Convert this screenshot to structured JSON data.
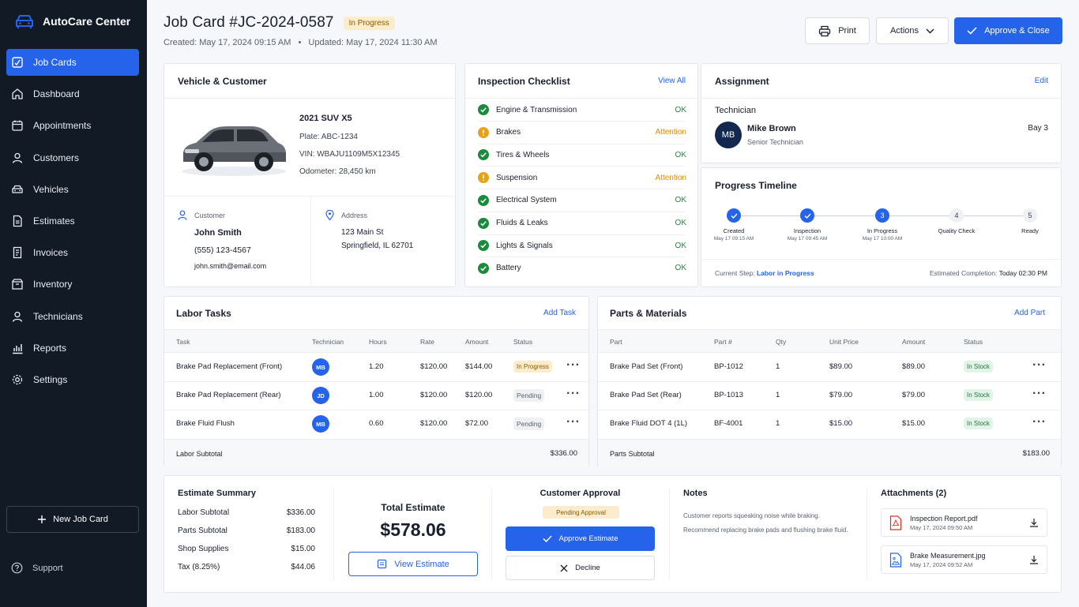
{
  "app": {
    "name": "AutoCare Center"
  },
  "sidebar": {
    "items": [
      {
        "label": "Job Cards",
        "icon": "job-cards-icon",
        "active": true
      },
      {
        "label": "Dashboard",
        "icon": "home-icon"
      },
      {
        "label": "Appointments",
        "icon": "calendar-icon"
      },
      {
        "label": "Customers",
        "icon": "user-icon"
      },
      {
        "label": "Vehicles",
        "icon": "car-icon"
      },
      {
        "label": "Estimates",
        "icon": "document-icon"
      },
      {
        "label": "Invoices",
        "icon": "invoice-icon"
      },
      {
        "label": "Inventory",
        "icon": "box-icon"
      },
      {
        "label": "Technicians",
        "icon": "wrench-user-icon"
      },
      {
        "label": "Reports",
        "icon": "bar-chart-icon"
      },
      {
        "label": "Settings",
        "icon": "gear-icon"
      }
    ],
    "new_job_label": "New Job Card",
    "support_label": "Support"
  },
  "header": {
    "title": "Job Card #JC-2024-0587",
    "status": "In Progress",
    "created": "Created: May 17, 2024 09:15 AM",
    "separator": "•",
    "updated": "Updated: May 17, 2024 11:30 AM",
    "print_label": "Print",
    "actions_label": "Actions",
    "approve_close_label": "Approve & Close"
  },
  "vehicle": {
    "heading": "Vehicle & Customer",
    "model": "2021 SUV X5",
    "plate": "Plate: ABC-1234",
    "vin": "VIN: WBAJU1109M5X12345",
    "odometer": "Odometer: 28,450 km",
    "customer_label": "Customer",
    "customer_name": "John Smith",
    "phone": "(555) 123-4567",
    "email": "john.smith@email.com",
    "address_label": "Address",
    "address_line1": "123 Main St",
    "address_line2": "Springfield, IL 62701"
  },
  "checklist": {
    "heading": "Inspection Checklist",
    "view_all": "View All",
    "items": [
      {
        "label": "Engine & Transmission",
        "status": "OK",
        "state": "ok"
      },
      {
        "label": "Brakes",
        "status": "Attention",
        "state": "attention"
      },
      {
        "label": "Tires & Wheels",
        "status": "OK",
        "state": "ok"
      },
      {
        "label": "Suspension",
        "status": "Attention",
        "state": "attention"
      },
      {
        "label": "Electrical System",
        "status": "OK",
        "state": "ok"
      },
      {
        "label": "Fluids & Leaks",
        "status": "OK",
        "state": "ok"
      },
      {
        "label": "Lights & Signals",
        "status": "OK",
        "state": "ok"
      },
      {
        "label": "Battery",
        "status": "OK",
        "state": "ok"
      }
    ]
  },
  "assignment": {
    "heading": "Assignment",
    "edit": "Edit",
    "technician_label": "Technician",
    "initials": "MB",
    "name": "Mike Brown",
    "role": "Senior Technician",
    "bay": "Bay 3"
  },
  "timeline": {
    "heading": "Progress Timeline",
    "steps": [
      {
        "num": "",
        "label": "Created",
        "date": "May 17 09:15 AM",
        "state": "done"
      },
      {
        "num": "",
        "label": "Inspection",
        "date": "May 17 09:45 AM",
        "state": "done"
      },
      {
        "num": "3",
        "label": "In Progress",
        "date": "May 17 10:00 AM",
        "state": "current"
      },
      {
        "num": "4",
        "label": "Quality Check",
        "date": "",
        "state": "todo"
      },
      {
        "num": "5",
        "label": "Ready",
        "date": "",
        "state": "todo"
      }
    ],
    "current_step_label": "Current Step:",
    "current_step_value": "Labor in Progress",
    "est_completion_label": "Estimated Completion:",
    "est_completion_value": "Today 02:30 PM"
  },
  "labor": {
    "heading": "Labor Tasks",
    "add": "Add Task",
    "columns": [
      "Task",
      "Technician",
      "Hours",
      "Rate",
      "Amount",
      "Status"
    ],
    "rows": [
      {
        "task": "Brake Pad Replacement (Front)",
        "tech": "MB",
        "hours": "1.20",
        "rate": "$120.00",
        "amount": "$144.00",
        "status": "In Progress"
      },
      {
        "task": "Brake Pad Replacement (Rear)",
        "tech": "JD",
        "hours": "1.00",
        "rate": "$120.00",
        "amount": "$120.00",
        "status": "Pending"
      },
      {
        "task": "Brake Fluid Flush",
        "tech": "MB",
        "hours": "0.60",
        "rate": "$120.00",
        "amount": "$72.00",
        "status": "Pending"
      }
    ],
    "subtotal_label": "Labor Subtotal",
    "subtotal": "$336.00"
  },
  "parts": {
    "heading": "Parts & Materials",
    "add": "Add Part",
    "columns": [
      "Part",
      "Part #",
      "Qty",
      "Unit Price",
      "Amount",
      "Status"
    ],
    "rows": [
      {
        "part": "Brake Pad Set (Front)",
        "num": "BP-1012",
        "qty": "1",
        "unit": "$89.00",
        "amount": "$89.00",
        "status": "In Stock"
      },
      {
        "part": "Brake Pad Set (Rear)",
        "num": "BP-1013",
        "qty": "1",
        "unit": "$79.00",
        "amount": "$79.00",
        "status": "In Stock"
      },
      {
        "part": "Brake Fluid DOT 4 (1L)",
        "num": "BF-4001",
        "qty": "1",
        "unit": "$15.00",
        "amount": "$15.00",
        "status": "In Stock"
      }
    ],
    "subtotal_label": "Parts Subtotal",
    "subtotal": "$183.00"
  },
  "estimate": {
    "heading": "Estimate Summary",
    "rows": [
      {
        "label": "Labor Subtotal",
        "value": "$336.00"
      },
      {
        "label": "Parts Subtotal",
        "value": "$183.00"
      },
      {
        "label": "Shop Supplies",
        "value": "$15.00"
      },
      {
        "label": "Tax (8.25%)",
        "value": "$44.06"
      }
    ],
    "total_label": "Total Estimate",
    "total": "$578.06",
    "view_label": "View Estimate"
  },
  "approval": {
    "heading": "Customer Approval",
    "status": "Pending Approval",
    "approve_label": "Approve Estimate",
    "decline_label": "Decline"
  },
  "notes": {
    "heading": "Notes",
    "line1": "Customer reports squeaking noise while braking.",
    "line2": "Recommend replacing brake pads and flushing brake fluid."
  },
  "attachments": {
    "heading": "Attachments (2)",
    "items": [
      {
        "name": "Inspection Report.pdf",
        "date": "May 17, 2024 09:50 AM",
        "icon": "pdf-icon"
      },
      {
        "name": "Brake Measurement.jpg",
        "date": "May 17, 2024 09:52 AM",
        "icon": "image-file-icon"
      }
    ]
  },
  "colors": {
    "accent": "#2563eb",
    "sidebar": "#121a26",
    "ok": "#1b8a3d",
    "attention": "#d98b00"
  }
}
